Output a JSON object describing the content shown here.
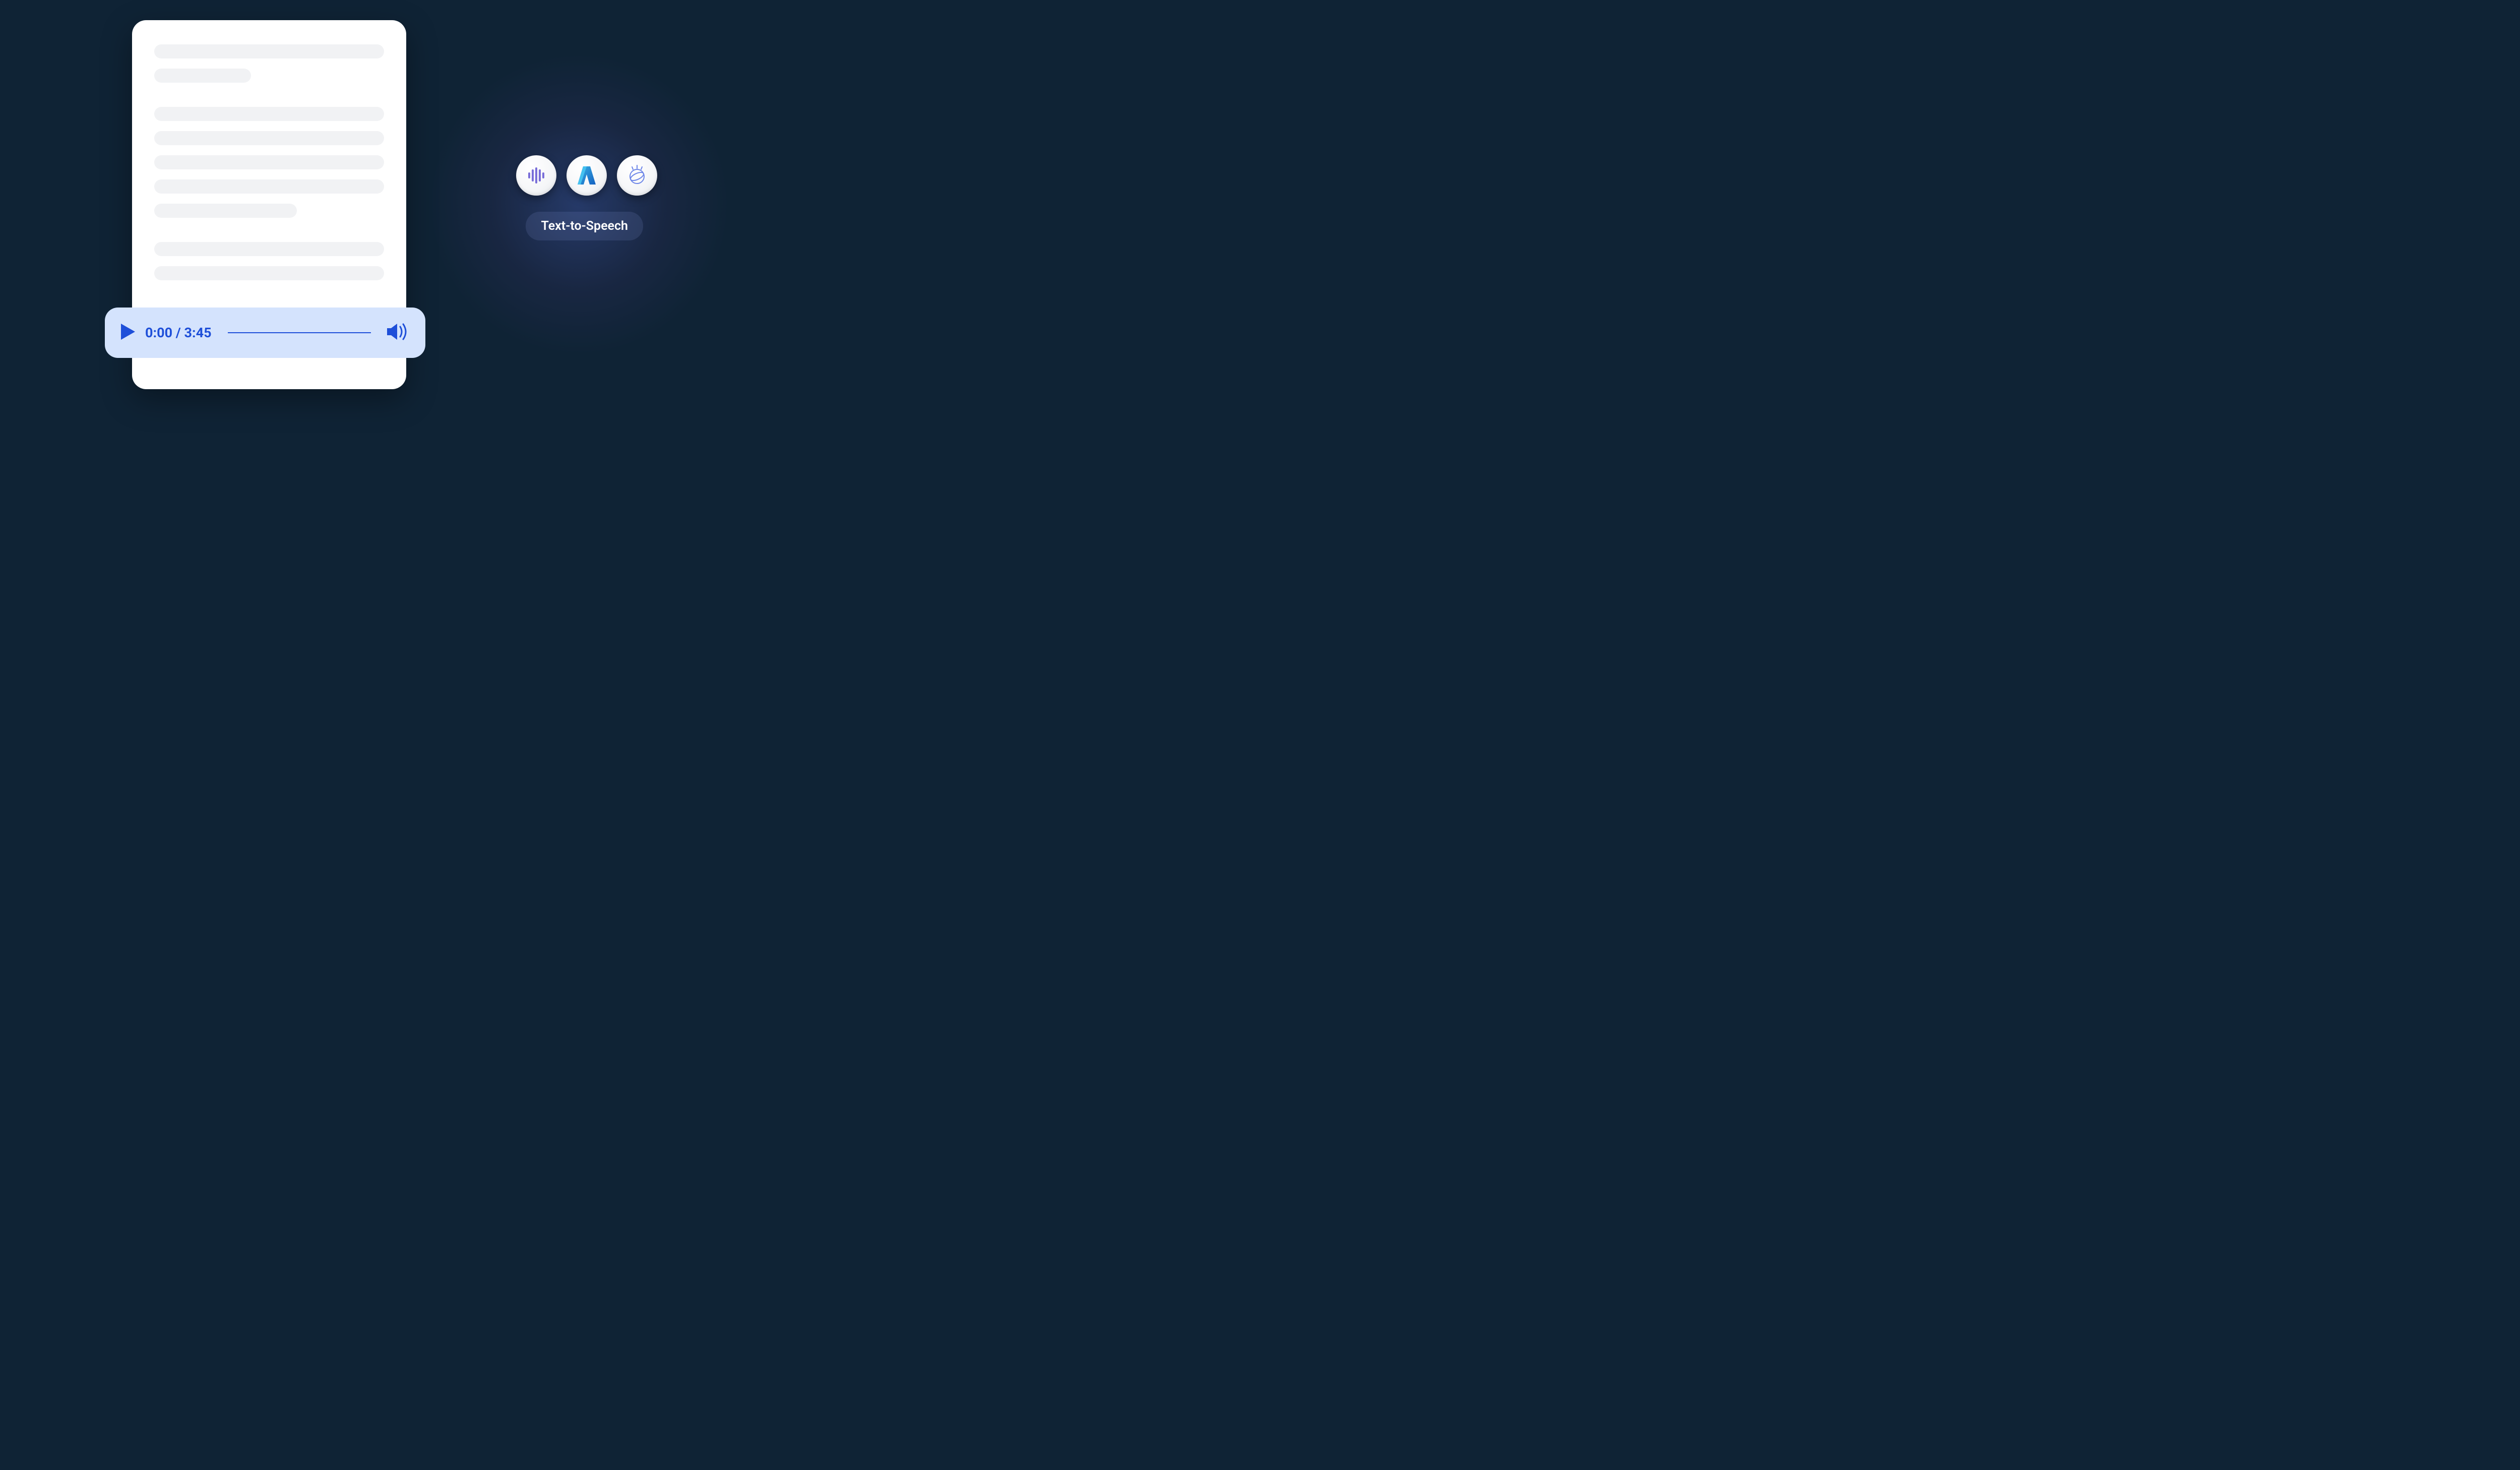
{
  "audioPlayer": {
    "currentTime": "0:00",
    "duration": "3:45",
    "separator": " / "
  },
  "badge": {
    "label": "Text-to-Speech"
  },
  "services": [
    {
      "name": "sound-waves-icon"
    },
    {
      "name": "azure-a-icon"
    },
    {
      "name": "watson-globe-icon"
    }
  ]
}
